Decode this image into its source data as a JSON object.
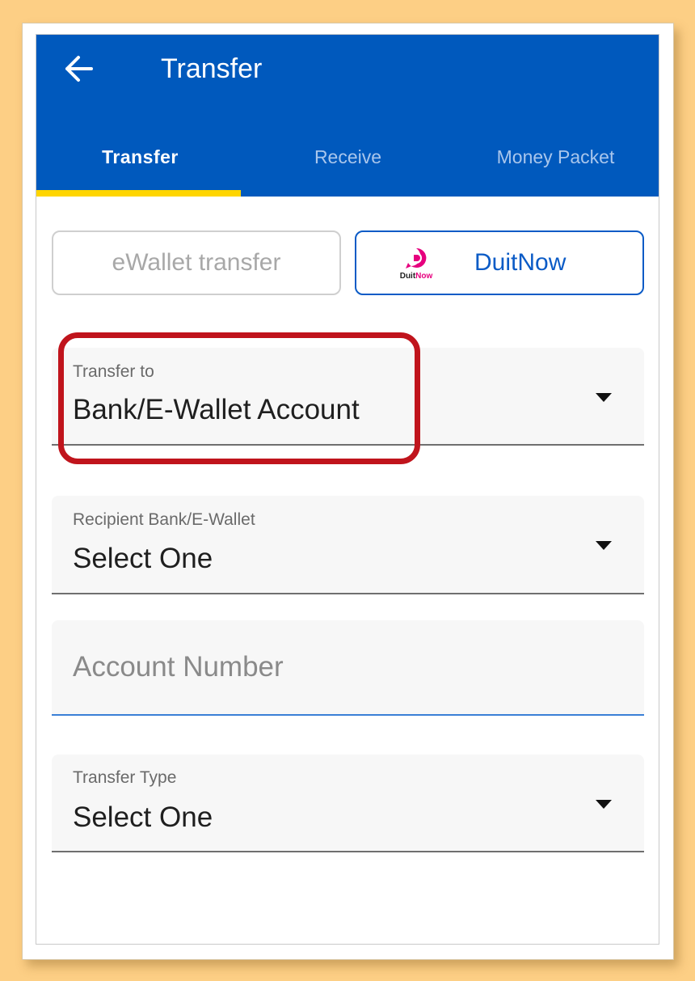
{
  "header": {
    "title": "Transfer",
    "back_icon": "arrow-left-icon",
    "background": "#0059bd"
  },
  "tabs": [
    {
      "label": "Transfer",
      "active": true
    },
    {
      "label": "Receive",
      "active": false
    },
    {
      "label": "Money Packet",
      "active": false
    }
  ],
  "tab_indicator_color": "#ffd500",
  "transfer_method": {
    "ewallet_label": "eWallet transfer",
    "duitnow_label": "DuitNow",
    "duitnow_logo": {
      "icon": "duitnow-logo-icon",
      "text_a": "Duit",
      "text_b": "Now"
    },
    "selected": "DuitNow"
  },
  "form": {
    "transfer_to": {
      "label": "Transfer to",
      "value": "Bank/E-Wallet Account"
    },
    "recipient_bank": {
      "label": "Recipient Bank/E-Wallet",
      "value": "Select One"
    },
    "account_number": {
      "placeholder": "Account Number"
    },
    "transfer_type": {
      "label": "Transfer Type",
      "value": "Select One"
    }
  },
  "highlight_color": "#c0141c"
}
